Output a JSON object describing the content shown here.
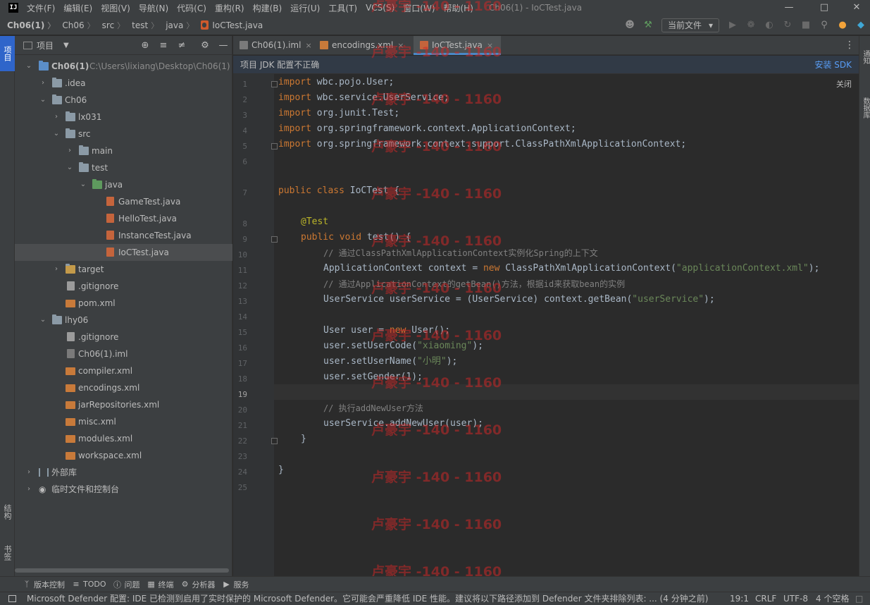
{
  "menubar": {
    "logo": "IJ",
    "items": [
      "文件(F)",
      "编辑(E)",
      "视图(V)",
      "导航(N)",
      "代码(C)",
      "重构(R)",
      "构建(B)",
      "运行(U)",
      "工具(T)",
      "VCS(S)",
      "窗口(W)",
      "帮助(H)"
    ],
    "window_title": "Ch06(1) - IoCTest.java"
  },
  "navbar": {
    "breadcrumbs": [
      "Ch06(1)",
      "Ch06",
      "src",
      "test",
      "java",
      "IoCTest.java"
    ],
    "run_config": "当前文件"
  },
  "left_strip": {
    "project": "项目",
    "structure": "结构",
    "bookmarks": "书签"
  },
  "right_strip": {
    "notifications": "通知",
    "database": "数据库"
  },
  "project_panel": {
    "title": "项目",
    "tree": [
      {
        "label": "Ch06(1)",
        "sub": "C:\\Users\\lixiang\\Desktop\\Ch06(1)",
        "bold": true
      },
      {
        "label": ".idea"
      },
      {
        "label": "Ch06"
      },
      {
        "label": "lx031"
      },
      {
        "label": "src"
      },
      {
        "label": "main"
      },
      {
        "label": "test"
      },
      {
        "label": "java"
      },
      {
        "label": "GameTest.java"
      },
      {
        "label": "HelloTest.java"
      },
      {
        "label": "InstanceTest.java"
      },
      {
        "label": "IoCTest.java"
      },
      {
        "label": "target"
      },
      {
        "label": ".gitignore"
      },
      {
        "label": "pom.xml"
      },
      {
        "label": "lhy06"
      },
      {
        "label": ".gitignore"
      },
      {
        "label": "Ch06(1).iml"
      },
      {
        "label": "compiler.xml"
      },
      {
        "label": "encodings.xml"
      },
      {
        "label": "jarRepositories.xml"
      },
      {
        "label": "misc.xml"
      },
      {
        "label": "modules.xml"
      },
      {
        "label": "workspace.xml"
      },
      {
        "label": "外部库"
      },
      {
        "label": "临时文件和控制台"
      }
    ]
  },
  "editor": {
    "tabs": [
      {
        "label": "Ch06(1).iml",
        "close": "×"
      },
      {
        "label": "encodings.xml",
        "close": "×"
      },
      {
        "label": "IoCTest.java",
        "close": "×"
      }
    ],
    "banner_text": "项目 JDK 配置不正确",
    "banner_link": "安装 SDK",
    "close_hint": "关闭",
    "current_line": "19",
    "line_numbers": [
      "1",
      "2",
      "3",
      "4",
      "5",
      "6",
      "7",
      "8",
      "9",
      "10",
      "11",
      "12",
      "13",
      "14",
      "15",
      "16",
      "17",
      "18",
      "19",
      "20",
      "21",
      "22",
      "23",
      "24",
      "25"
    ],
    "code": {
      "l1": "wbc.pojo.User;",
      "l2": "wbc.service.UserService;",
      "l3": "org.junit.Test;",
      "l4": "org.springframework.context.ApplicationContext;",
      "l5": "org.springframework.context.support.ClassPathXmlApplicationContext;",
      "kw_import": "import",
      "kw_public": "public",
      "kw_class": "class",
      "kw_void": "void",
      "kw_new": "new",
      "l7_name": " IoCTest {",
      "l8_ann": "@Test",
      "l9_rest": " test() {",
      "l10_cmt": "// 通过ClassPathXmlApplicationContext实例化Spring的上下文",
      "l11_a": "ApplicationContext context = ",
      "l11_b": " ClassPathXmlApplicationContext(",
      "l11_str": "\"applicationContext.xml\"",
      "l11_c": ");",
      "l12_cmt": "// 通过ApplicationContext的getBean()方法，根据id来获取bean的实例",
      "l13_a": "UserService userService = (UserService) context.getBean(",
      "l13_str": "\"userService\"",
      "l13_c": ");",
      "l15_a": "User user = ",
      "l15_b": " User();",
      "l16_a": "user.setUserCode(",
      "l16_str": "\"xiaoming\"",
      "l16_c": ");",
      "l17_a": "user.setUserName(",
      "l17_str": "\"小明\"",
      "l17_c": ");",
      "l18": "user.setGender(1);",
      "l20_cmt": "// 执行addNewUser方法",
      "l21": "userService.addNewUser(user);",
      "l22": "}",
      "l24": "}"
    }
  },
  "watermark": "卢豪宇 -140 - 1160",
  "bottom_tools": [
    "版本控制",
    "TODO",
    "问题",
    "终端",
    "分析器",
    "服务"
  ],
  "statusbar": {
    "message": "Microsoft Defender 配置: IDE 已检测到启用了实时保护的 Microsoft Defender。它可能会严重降低 IDE 性能。建议将以下路径添加到 Defender 文件夹排除列表: ... (4 分钟之前)",
    "position": "19:1",
    "line_sep": "CRLF",
    "encoding": "UTF-8",
    "indent": "4 个空格"
  }
}
